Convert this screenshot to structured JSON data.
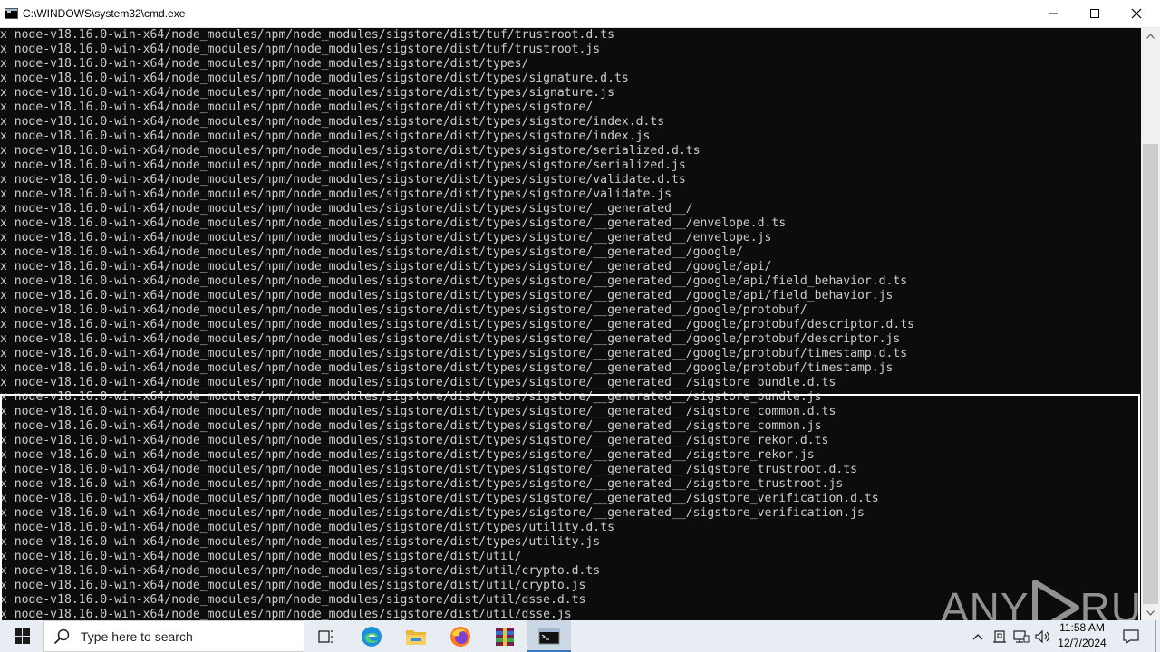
{
  "window": {
    "title": "C:\\WINDOWS\\system32\\cmd.exe",
    "minimize_icon": "minimize-icon",
    "maximize_icon": "maximize-icon",
    "close_icon": "close-icon"
  },
  "console": {
    "lines": [
      "x node-v18.16.0-win-x64/node_modules/npm/node_modules/sigstore/dist/tuf/trustroot.d.ts",
      "x node-v18.16.0-win-x64/node_modules/npm/node_modules/sigstore/dist/tuf/trustroot.js",
      "x node-v18.16.0-win-x64/node_modules/npm/node_modules/sigstore/dist/types/",
      "x node-v18.16.0-win-x64/node_modules/npm/node_modules/sigstore/dist/types/signature.d.ts",
      "x node-v18.16.0-win-x64/node_modules/npm/node_modules/sigstore/dist/types/signature.js",
      "x node-v18.16.0-win-x64/node_modules/npm/node_modules/sigstore/dist/types/sigstore/",
      "x node-v18.16.0-win-x64/node_modules/npm/node_modules/sigstore/dist/types/sigstore/index.d.ts",
      "x node-v18.16.0-win-x64/node_modules/npm/node_modules/sigstore/dist/types/sigstore/index.js",
      "x node-v18.16.0-win-x64/node_modules/npm/node_modules/sigstore/dist/types/sigstore/serialized.d.ts",
      "x node-v18.16.0-win-x64/node_modules/npm/node_modules/sigstore/dist/types/sigstore/serialized.js",
      "x node-v18.16.0-win-x64/node_modules/npm/node_modules/sigstore/dist/types/sigstore/validate.d.ts",
      "x node-v18.16.0-win-x64/node_modules/npm/node_modules/sigstore/dist/types/sigstore/validate.js",
      "x node-v18.16.0-win-x64/node_modules/npm/node_modules/sigstore/dist/types/sigstore/__generated__/",
      "x node-v18.16.0-win-x64/node_modules/npm/node_modules/sigstore/dist/types/sigstore/__generated__/envelope.d.ts",
      "x node-v18.16.0-win-x64/node_modules/npm/node_modules/sigstore/dist/types/sigstore/__generated__/envelope.js",
      "x node-v18.16.0-win-x64/node_modules/npm/node_modules/sigstore/dist/types/sigstore/__generated__/google/",
      "x node-v18.16.0-win-x64/node_modules/npm/node_modules/sigstore/dist/types/sigstore/__generated__/google/api/",
      "x node-v18.16.0-win-x64/node_modules/npm/node_modules/sigstore/dist/types/sigstore/__generated__/google/api/field_behavior.d.ts",
      "x node-v18.16.0-win-x64/node_modules/npm/node_modules/sigstore/dist/types/sigstore/__generated__/google/api/field_behavior.js",
      "x node-v18.16.0-win-x64/node_modules/npm/node_modules/sigstore/dist/types/sigstore/__generated__/google/protobuf/",
      "x node-v18.16.0-win-x64/node_modules/npm/node_modules/sigstore/dist/types/sigstore/__generated__/google/protobuf/descriptor.d.ts",
      "x node-v18.16.0-win-x64/node_modules/npm/node_modules/sigstore/dist/types/sigstore/__generated__/google/protobuf/descriptor.js",
      "x node-v18.16.0-win-x64/node_modules/npm/node_modules/sigstore/dist/types/sigstore/__generated__/google/protobuf/timestamp.d.ts",
      "x node-v18.16.0-win-x64/node_modules/npm/node_modules/sigstore/dist/types/sigstore/__generated__/google/protobuf/timestamp.js",
      "x node-v18.16.0-win-x64/node_modules/npm/node_modules/sigstore/dist/types/sigstore/__generated__/sigstore_bundle.d.ts",
      "x node-v18.16.0-win-x64/node_modules/npm/node_modules/sigstore/dist/types/sigstore/__generated__/sigstore_bundle.js",
      "x node-v18.16.0-win-x64/node_modules/npm/node_modules/sigstore/dist/types/sigstore/__generated__/sigstore_common.d.ts",
      "x node-v18.16.0-win-x64/node_modules/npm/node_modules/sigstore/dist/types/sigstore/__generated__/sigstore_common.js",
      "x node-v18.16.0-win-x64/node_modules/npm/node_modules/sigstore/dist/types/sigstore/__generated__/sigstore_rekor.d.ts",
      "x node-v18.16.0-win-x64/node_modules/npm/node_modules/sigstore/dist/types/sigstore/__generated__/sigstore_rekor.js",
      "x node-v18.16.0-win-x64/node_modules/npm/node_modules/sigstore/dist/types/sigstore/__generated__/sigstore_trustroot.d.ts",
      "x node-v18.16.0-win-x64/node_modules/npm/node_modules/sigstore/dist/types/sigstore/__generated__/sigstore_trustroot.js",
      "x node-v18.16.0-win-x64/node_modules/npm/node_modules/sigstore/dist/types/sigstore/__generated__/sigstore_verification.d.ts",
      "x node-v18.16.0-win-x64/node_modules/npm/node_modules/sigstore/dist/types/sigstore/__generated__/sigstore_verification.js",
      "x node-v18.16.0-win-x64/node_modules/npm/node_modules/sigstore/dist/types/utility.d.ts",
      "x node-v18.16.0-win-x64/node_modules/npm/node_modules/sigstore/dist/types/utility.js",
      "x node-v18.16.0-win-x64/node_modules/npm/node_modules/sigstore/dist/util/",
      "x node-v18.16.0-win-x64/node_modules/npm/node_modules/sigstore/dist/util/crypto.d.ts",
      "x node-v18.16.0-win-x64/node_modules/npm/node_modules/sigstore/dist/util/crypto.js",
      "x node-v18.16.0-win-x64/node_modules/npm/node_modules/sigstore/dist/util/dsse.d.ts",
      "x node-v18.16.0-win-x64/node_modules/npm/node_modules/sigstore/dist/util/dsse.js"
    ]
  },
  "watermark": {
    "text_left": "ANY",
    "text_right": "RUN"
  },
  "taskbar": {
    "search_placeholder": "Type here to search",
    "apps": [
      "task-view-icon",
      "edge-icon",
      "file-explorer-icon",
      "firefox-icon",
      "winrar-icon",
      "cmd-icon"
    ],
    "clock_time": "11:58 AM",
    "clock_date": "12/7/2024"
  }
}
